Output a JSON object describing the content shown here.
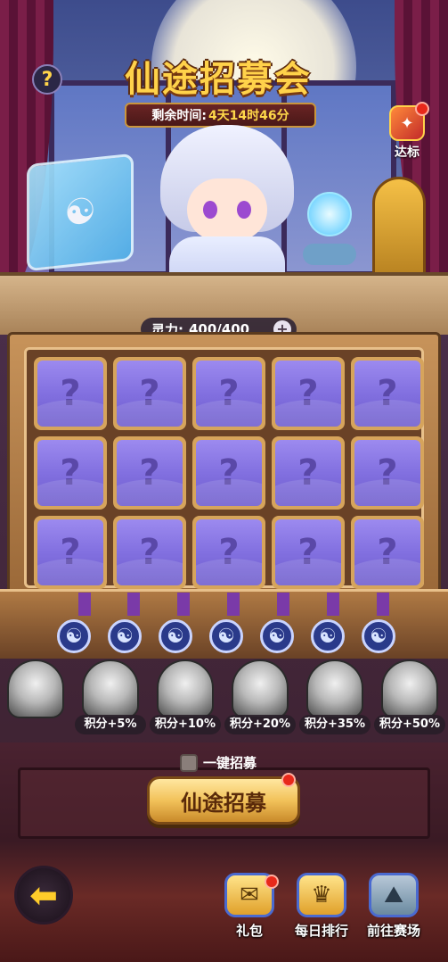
{
  "event": {
    "title": "仙途招募会",
    "timer_label": "剩余时间:",
    "timer_value": "4天14时46分"
  },
  "help_label": "?",
  "achievement": {
    "label": "达标",
    "icon": "achievement-book-icon"
  },
  "spirit": {
    "label": "灵力:",
    "value": "400/400",
    "add_icon": "+"
  },
  "cards": {
    "placeholder": "?",
    "count": 15
  },
  "taiji_icon": "☯",
  "heroes": [
    {
      "bonus": ""
    },
    {
      "bonus": "积分+5%"
    },
    {
      "bonus": "积分+10%"
    },
    {
      "bonus": "积分+20%"
    },
    {
      "bonus": "积分+35%"
    },
    {
      "bonus": "积分+50%"
    }
  ],
  "one_key": {
    "label": "一键招募",
    "checked": false
  },
  "recruit_button": {
    "label": "仙途招募"
  },
  "back_icon": "arrow-left-icon",
  "actions": [
    {
      "label": "礼包",
      "icon": "gift-scroll-icon"
    },
    {
      "label": "每日排行",
      "icon": "ranking-icon"
    },
    {
      "label": "前往赛场",
      "icon": "arena-icon"
    }
  ],
  "colors": {
    "card_face": "#8270e0",
    "title_gold": "#ffd24a",
    "timer_value": "#ffd84a",
    "red_dot": "#e8281a"
  }
}
